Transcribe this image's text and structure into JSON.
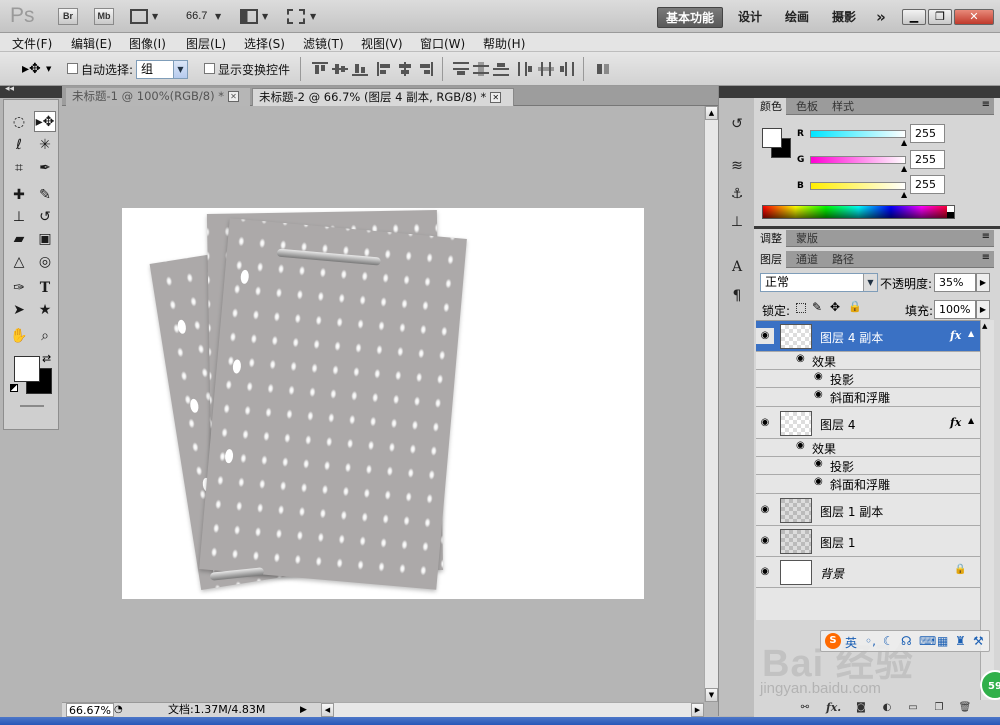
{
  "app": {
    "logo": "Ps",
    "bridge_label": "Br",
    "minibridge_label": "Mb",
    "zoom_level": "66.7",
    "workspaces": [
      "基本功能",
      "设计",
      "绘画",
      "摄影"
    ],
    "more_label": "»"
  },
  "menu": [
    "文件(F)",
    "编辑(E)",
    "图像(I)",
    "图层(L)",
    "选择(S)",
    "滤镜(T)",
    "视图(V)",
    "窗口(W)",
    "帮助(H)"
  ],
  "options": {
    "auto_select_label": "自动选择:",
    "auto_select_value": "组",
    "show_transform_label": "显示变换控件"
  },
  "tabs": [
    {
      "label": "未标题-1 @ 100%(RGB/8) *",
      "active": false
    },
    {
      "label": "未标题-2 @ 66.7% (图层 4 副本, RGB/8) *",
      "active": true
    }
  ],
  "status": {
    "zoom": "66.67%",
    "doc_info": "文档:1.37M/4.83M"
  },
  "color_panel": {
    "tabs": [
      "颜色",
      "色板",
      "样式"
    ],
    "channels": [
      {
        "label": "R",
        "value": "255",
        "color": "#00e5ff"
      },
      {
        "label": "G",
        "value": "255",
        "color": "#ff00d4"
      },
      {
        "label": "B",
        "value": "255",
        "color": "#ffee00"
      }
    ],
    "foreground": "#ffffff",
    "background": "#000000"
  },
  "adjust_panel": {
    "tabs": [
      "调整",
      "蒙版"
    ]
  },
  "layers_panel": {
    "tabs": [
      "图层",
      "通道",
      "路径"
    ],
    "blend_mode": "正常",
    "opacity_label": "不透明度:",
    "opacity": "35%",
    "lock_label": "锁定:",
    "fill_label": "填充:",
    "fill": "100%",
    "layers": [
      {
        "name": "图层 4 副本",
        "fx": "fx",
        "selected": true,
        "effects_label": "效果",
        "effects": [
          "投影",
          "斜面和浮雕"
        ]
      },
      {
        "name": "图层 4",
        "fx": "fx",
        "selected": false,
        "effects_label": "效果",
        "effects": [
          "投影",
          "斜面和浮雕"
        ]
      },
      {
        "name": "图层 1 副本",
        "fx": "",
        "selected": false
      },
      {
        "name": "图层 1",
        "fx": "",
        "selected": false
      },
      {
        "name": "背景",
        "fx": "",
        "selected": false,
        "locked": true
      }
    ]
  },
  "watermark": {
    "text": "Bai 经验",
    "url": "jingyan.baidu.com",
    "toolbar_label": "英",
    "badge": "59"
  }
}
